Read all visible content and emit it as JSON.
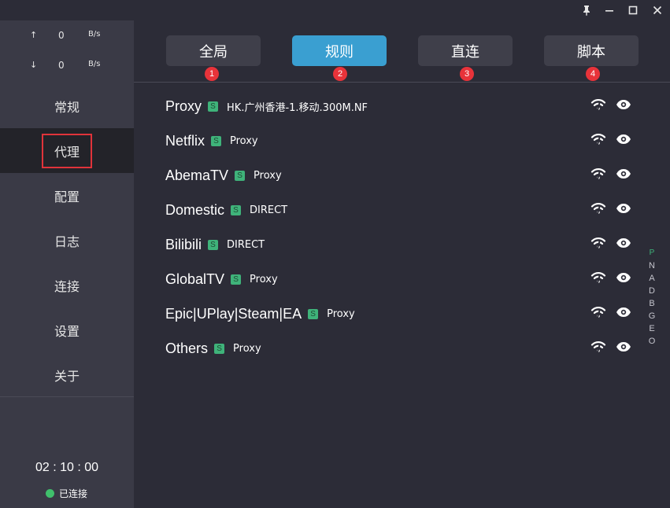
{
  "window": {
    "controls": [
      "pin-icon",
      "minimize-icon",
      "maximize-icon",
      "close-icon"
    ]
  },
  "traffic": {
    "up_arrow": "↑",
    "up_value": "0",
    "up_unit": "B/s",
    "down_arrow": "↓",
    "down_value": "0",
    "down_unit": "B/s"
  },
  "sidebar": {
    "items": [
      {
        "label": "常规",
        "active": false
      },
      {
        "label": "代理",
        "active": true
      },
      {
        "label": "配置",
        "active": false
      },
      {
        "label": "日志",
        "active": false
      },
      {
        "label": "连接",
        "active": false
      },
      {
        "label": "设置",
        "active": false
      },
      {
        "label": "关于",
        "active": false
      }
    ],
    "timer": "02 : 10 : 00",
    "status_label": "已连接",
    "status_color": "#40c06c"
  },
  "modes": [
    {
      "label": "全局",
      "badge": "1",
      "active": false
    },
    {
      "label": "规则",
      "badge": "2",
      "active": true
    },
    {
      "label": "直连",
      "badge": "3",
      "active": false
    },
    {
      "label": "脚本",
      "badge": "4",
      "active": false
    }
  ],
  "proxy_groups": [
    {
      "name": "Proxy",
      "tag": "S",
      "selected": "HK.广州香港-1.移动.300M.NF"
    },
    {
      "name": "Netflix",
      "tag": "S",
      "selected": "Proxy"
    },
    {
      "name": "AbemaTV",
      "tag": "S",
      "selected": "Proxy"
    },
    {
      "name": "Domestic",
      "tag": "S",
      "selected": "DIRECT"
    },
    {
      "name": "Bilibili",
      "tag": "S",
      "selected": "DIRECT"
    },
    {
      "name": "GlobalTV",
      "tag": "S",
      "selected": "Proxy"
    },
    {
      "name": "Epic|UPlay|Steam|EA",
      "tag": "S",
      "selected": "Proxy"
    },
    {
      "name": "Others",
      "tag": "S",
      "selected": "Proxy"
    }
  ],
  "sort_letters": [
    "P",
    "N",
    "A",
    "D",
    "B",
    "G",
    "E",
    "O"
  ],
  "colors": {
    "accent": "#3a9fd1",
    "badge": "#e8333a",
    "tag": "#3fb37a",
    "highlight_box": "#e0333a"
  }
}
